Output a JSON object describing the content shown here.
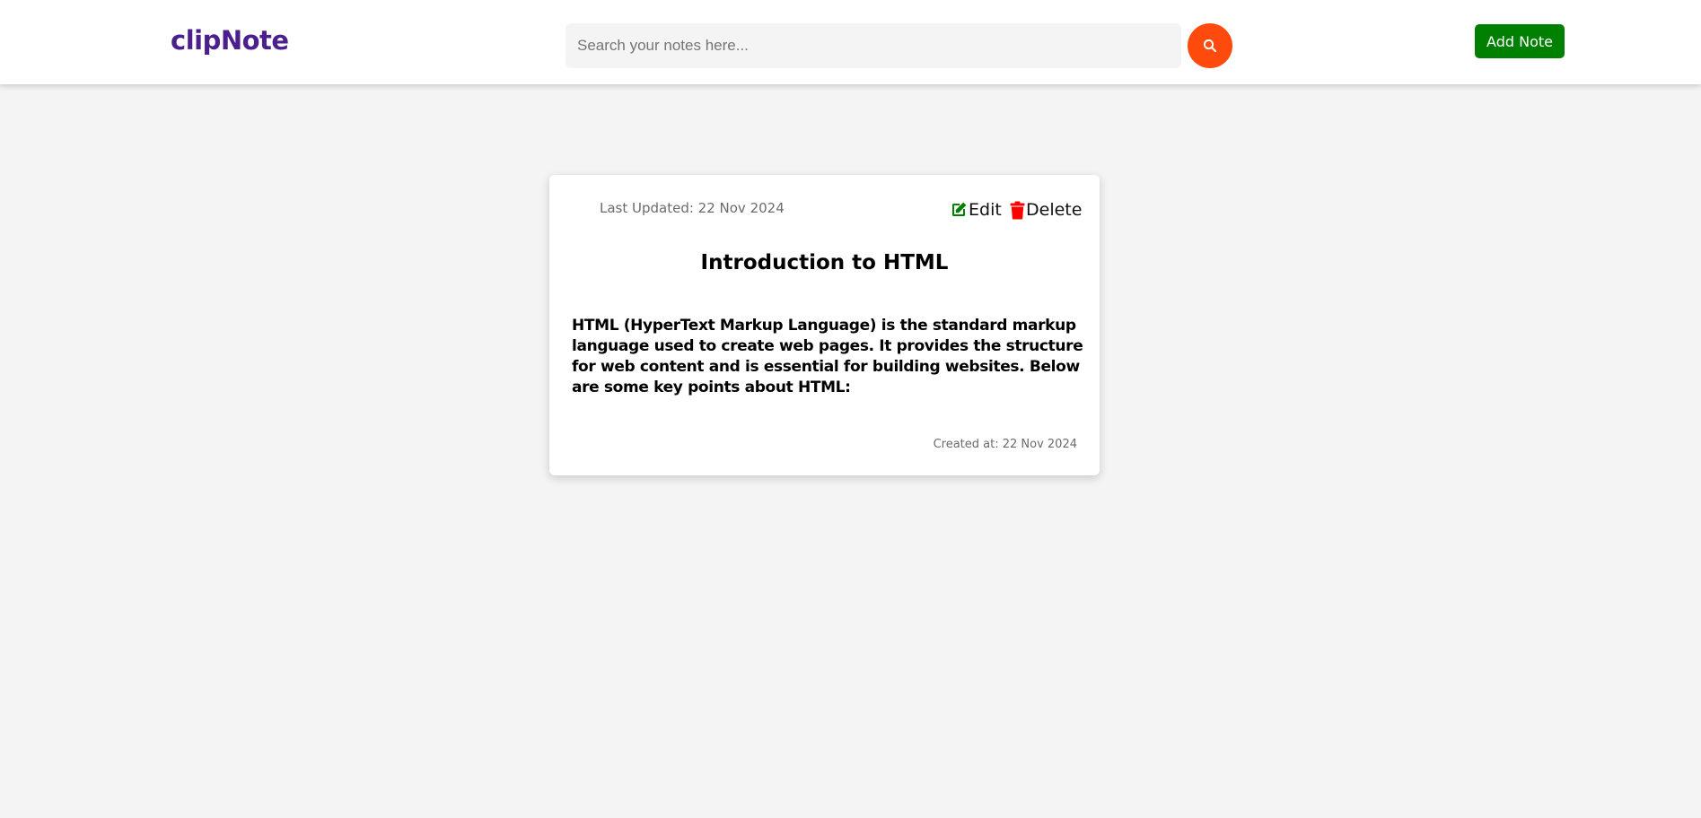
{
  "header": {
    "logo": "clipNote",
    "search": {
      "placeholder": "Search your notes here...",
      "value": "",
      "button_icon": "search-icon",
      "button_color": "#fe4a0c"
    },
    "add_note_label": "Add Note",
    "add_note_color": "#008000"
  },
  "note": {
    "last_updated": "Last Updated: 22 Nov 2024",
    "edit_label": "Edit",
    "edit_icon": "edit-icon",
    "edit_icon_color": "#008000",
    "delete_label": "Delete",
    "delete_icon": "trash-icon",
    "delete_icon_color": "#ff0000",
    "title": "Introduction to HTML",
    "body": "HTML (HyperText Markup Language) is the standard markup language used to create web pages. It provides the structure for web content and is essential for building websites. Below are some key points about HTML:",
    "created_at": "Created at: 22 Nov 2024"
  },
  "colors": {
    "logo": "#4b1f8c",
    "background": "#f4f4f4",
    "card": "#ffffff"
  }
}
